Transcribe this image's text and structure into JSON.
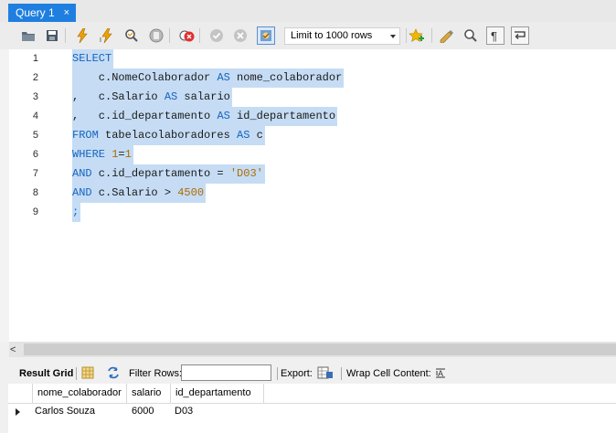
{
  "tab": {
    "title": "Query 1",
    "close": "×"
  },
  "toolbar": {
    "limit_label": "Limit to 1000 rows",
    "icons": [
      "folder-icon",
      "save-icon",
      "execute-icon",
      "execute-current-icon",
      "explain-icon",
      "stop-icon",
      "toggle-error-icon",
      "commit-icon",
      "rollback-icon",
      "autocommit-icon",
      "favorite-add-icon",
      "beautify-icon",
      "find-icon",
      "invisible-chars-icon",
      "wrap-icon"
    ]
  },
  "editor": {
    "lines": [
      {
        "n": "1",
        "tokens": [
          [
            "kw",
            "SELECT"
          ]
        ]
      },
      {
        "n": "2",
        "tokens": [
          [
            "tx",
            "    c.NomeColaborador "
          ],
          [
            "kw",
            "AS"
          ],
          [
            "tx",
            " nome_colaborador"
          ]
        ]
      },
      {
        "n": "3",
        "tokens": [
          [
            "tx",
            ",   c.Salario "
          ],
          [
            "kw",
            "AS"
          ],
          [
            "tx",
            " salario"
          ]
        ]
      },
      {
        "n": "4",
        "tokens": [
          [
            "tx",
            ",   c.id_departamento "
          ],
          [
            "kw",
            "AS"
          ],
          [
            "tx",
            " id_departamento"
          ]
        ]
      },
      {
        "n": "5",
        "tokens": [
          [
            "kw",
            "FROM"
          ],
          [
            "tx",
            " tabelacolaboradores "
          ],
          [
            "kw",
            "AS"
          ],
          [
            "tx",
            " c"
          ]
        ]
      },
      {
        "n": "6",
        "tokens": [
          [
            "kw",
            "WHERE"
          ],
          [
            "tx",
            " "
          ],
          [
            "num",
            "1"
          ],
          [
            "tx",
            "="
          ],
          [
            "num",
            "1"
          ]
        ]
      },
      {
        "n": "7",
        "tokens": [
          [
            "kw",
            "AND"
          ],
          [
            "tx",
            " c.id_departamento = "
          ],
          [
            "str",
            "'D03'"
          ]
        ]
      },
      {
        "n": "8",
        "tokens": [
          [
            "kw",
            "AND"
          ],
          [
            "tx",
            " c.Salario > "
          ],
          [
            "num",
            "4500"
          ]
        ]
      },
      {
        "n": "9",
        "tokens": [
          [
            "kw",
            ";"
          ]
        ]
      }
    ]
  },
  "result_bar": {
    "result_grid": "Result Grid",
    "filter_rows": "Filter Rows:",
    "filter_value": "",
    "export": "Export:",
    "wrap_cell": "Wrap Cell Content:"
  },
  "grid": {
    "columns": [
      "nome_colaborador",
      "salario",
      "id_departamento"
    ],
    "rows": [
      [
        "Carlos Souza",
        "6000",
        "D03"
      ]
    ]
  },
  "colors": {
    "tab_active": "#1f7fe0",
    "selection": "#c5dcf4",
    "keyword": "#1565c0",
    "literal": "#b06b00"
  }
}
